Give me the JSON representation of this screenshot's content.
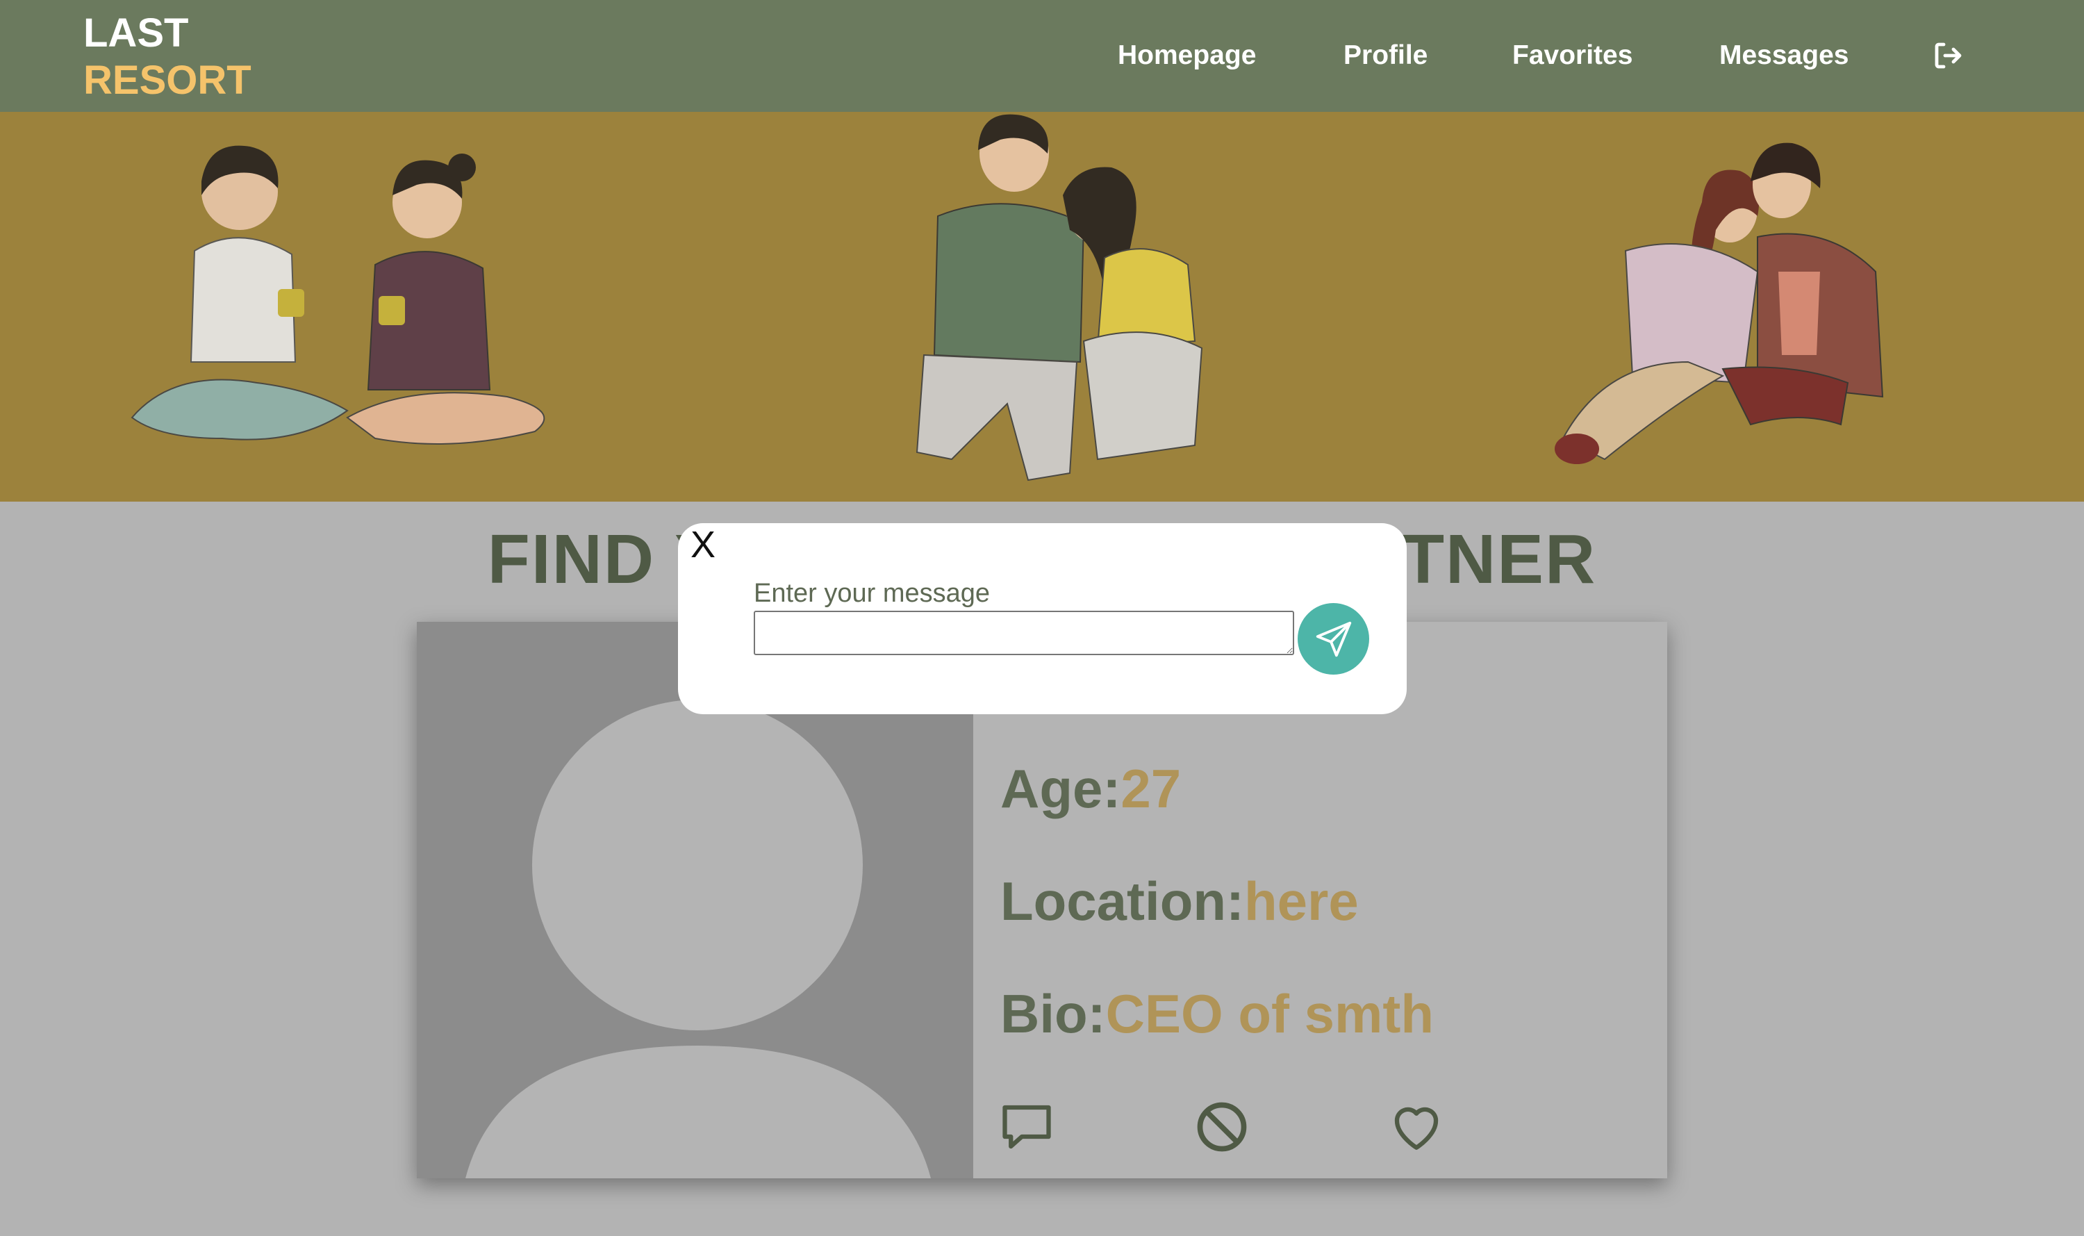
{
  "header": {
    "logo_line1": "LAST",
    "logo_line2": "RESORT",
    "nav": [
      {
        "label": "Homepage"
      },
      {
        "label": "Profile"
      },
      {
        "label": "Favorites"
      },
      {
        "label": "Messages"
      }
    ],
    "logout_icon": "logout-icon"
  },
  "hero": {
    "illustrations": [
      "couple-with-mugs",
      "couple-resting",
      "couple-hugging"
    ]
  },
  "main": {
    "title": "FIND YOUR PERFECT PARTNER"
  },
  "profile_card": {
    "age_label": "Age:",
    "age_value": "27",
    "location_label": "Location:",
    "location_value": "here",
    "bio_label": "Bio:",
    "bio_value": "CEO of smth",
    "actions": [
      "message-icon",
      "block-icon",
      "heart-icon"
    ]
  },
  "modal": {
    "close_label": "X",
    "message_label": "Enter your message",
    "message_value": "",
    "send_icon": "send-icon"
  },
  "colors": {
    "navbar": "#6b7a5e",
    "logo_accent": "#f5c36b",
    "hero": "#9c823c",
    "overlay_bg": "#b3b3b3",
    "title": "#4f5a45",
    "value_accent": "#b09458",
    "send_button": "#4db5a8"
  }
}
